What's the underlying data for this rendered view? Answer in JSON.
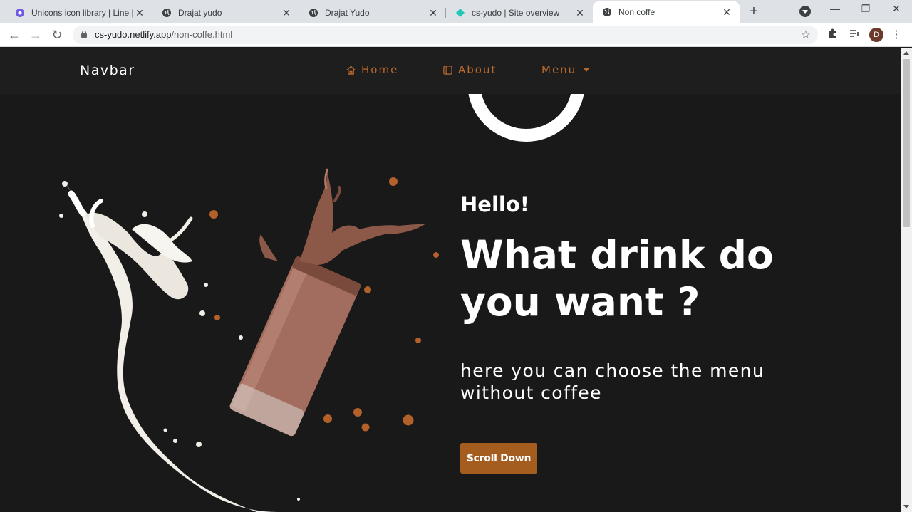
{
  "browser": {
    "tabs": [
      {
        "title": "Unicons icon library | Line | M",
        "favicon": "unicons-icon"
      },
      {
        "title": "Drajat yudo",
        "favicon": "globe-icon"
      },
      {
        "title": "Drajat Yudo",
        "favicon": "globe-icon"
      },
      {
        "title": "cs-yudo | Site overview",
        "favicon": "netlify-icon"
      },
      {
        "title": "Non coffe",
        "favicon": "globe-icon",
        "active": true
      }
    ],
    "url_host": "cs-yudo.netlify.app",
    "url_path": "/non-coffe.html",
    "profile_initial": "D"
  },
  "navbar": {
    "brand": "Navbar",
    "links": [
      {
        "label": "Home",
        "icon": "home-icon"
      },
      {
        "label": "About",
        "icon": "square-icon"
      },
      {
        "label": "Menu",
        "icon": "caret-down-icon"
      }
    ]
  },
  "hero": {
    "greeting": "Hello!",
    "headline_line1": "What drink do",
    "headline_line2": "you want ?",
    "subtitle": "here you can choose the menu without coffee",
    "button": "Scroll Down"
  },
  "colors": {
    "accent": "#b9692c",
    "button": "#a55c1f",
    "background": "#1a1919",
    "navbar": "#1f1e1e"
  }
}
